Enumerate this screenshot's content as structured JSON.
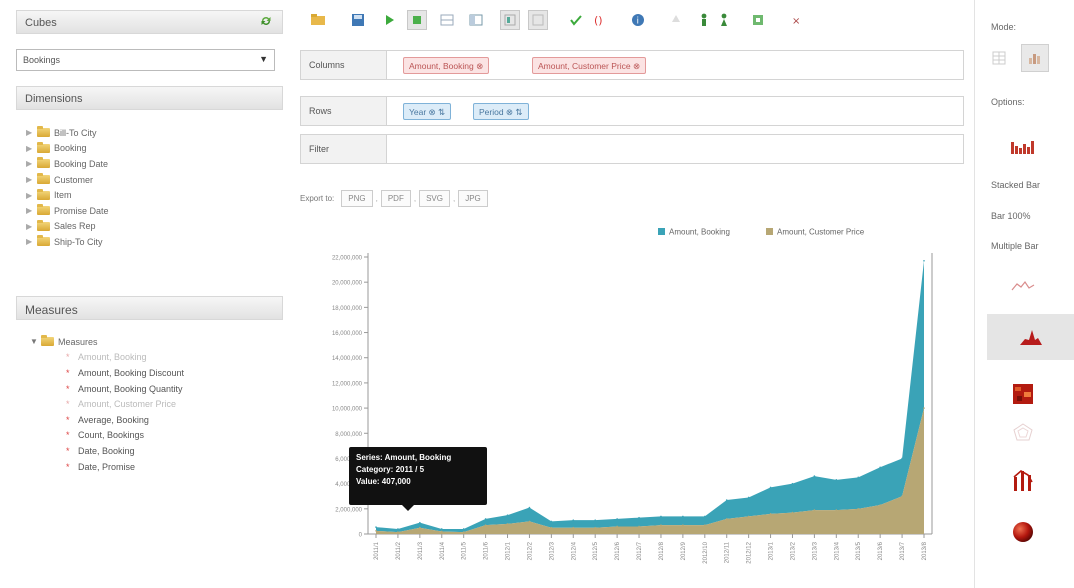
{
  "cubes": {
    "title": "Cubes",
    "selected": "Bookings"
  },
  "dimensions": {
    "title": "Dimensions",
    "items": [
      "Bill-To City",
      "Booking",
      "Booking Date",
      "Customer",
      "Item",
      "Promise Date",
      "Sales Rep",
      "Ship-To City"
    ]
  },
  "measures": {
    "title": "Measures",
    "folder": "Measures",
    "items": [
      {
        "label": "Amount, Booking",
        "used": true
      },
      {
        "label": "Amount, Booking Discount",
        "used": false
      },
      {
        "label": "Amount, Booking Quantity",
        "used": false
      },
      {
        "label": "Amount, Customer Price",
        "used": true
      },
      {
        "label": "Average, Booking",
        "used": false
      },
      {
        "label": "Count, Bookings",
        "used": false
      },
      {
        "label": "Date, Booking",
        "used": false
      },
      {
        "label": "Date, Promise",
        "used": false
      }
    ]
  },
  "toolbar": {
    "buttons": [
      "open-folder-icon",
      "save-icon",
      "play-icon",
      "run-icon",
      "grid-icon",
      "split-icon",
      "layout-icon",
      "blank-icon",
      "check-icon",
      "bracket-icon",
      "info-icon",
      "up-icon",
      "person-icon",
      "person2-icon",
      "export-icon",
      "close-icon"
    ]
  },
  "zones": {
    "columns": {
      "label": "Columns",
      "pills": [
        "Amount, Booking ⊗",
        "Amount, Customer Price ⊗"
      ]
    },
    "rows": {
      "label": "Rows",
      "pills": [
        "Year ⊗ ⇅",
        "Period ⊗ ⇅"
      ]
    },
    "filter": {
      "label": "Filter",
      "pills": []
    }
  },
  "export": {
    "label": "Export to:",
    "formats": [
      "PNG",
      "PDF",
      "SVG",
      "JPG"
    ]
  },
  "tooltip": {
    "series": "Series: Amount, Booking",
    "category": "Category: 2011 / 5",
    "value": "Value: 407,000"
  },
  "right": {
    "mode_label": "Mode:",
    "options_label": "Options:",
    "text_options": [
      "Stacked Bar",
      "Bar 100%",
      "Multiple Bar"
    ]
  },
  "chart_data": {
    "type": "area",
    "stacked": true,
    "legend_position": "top-right",
    "ylim": [
      0,
      22000000
    ],
    "y_ticks": [
      "22,000,000",
      "20,000,000",
      "18,000,000",
      "16,000,000",
      "14,000,000",
      "12,000,000",
      "10,000,000",
      "8,000,000",
      "6,000,000",
      "4,000,000",
      "2,000,000",
      "0"
    ],
    "categories": [
      "2011/1",
      "2011/2",
      "2011/3",
      "2011/4",
      "2011/5",
      "2011/6",
      "2012/1",
      "2012/2",
      "2012/3",
      "2012/4",
      "2012/5",
      "2012/6",
      "2012/7",
      "2012/8",
      "2012/9",
      "2012/10",
      "2012/11",
      "2012/12",
      "2013/1",
      "2013/2",
      "2013/3",
      "2013/4",
      "2013/5",
      "2013/6",
      "2013/7",
      "2013/8"
    ],
    "series": [
      {
        "name": "Amount, Customer Price",
        "color": "#b7a774",
        "values": [
          250000,
          150000,
          500000,
          200000,
          150000,
          700000,
          800000,
          1000000,
          500000,
          500000,
          500000,
          600000,
          600000,
          700000,
          700000,
          700000,
          1200000,
          1400000,
          1600000,
          1700000,
          1900000,
          1900000,
          2000000,
          2300000,
          3000000,
          10000000
        ]
      },
      {
        "name": "Amount, Booking",
        "color": "#3aa3b7",
        "values": [
          300000,
          250000,
          400000,
          200000,
          250000,
          500000,
          700000,
          1100000,
          500000,
          600000,
          600000,
          600000,
          700000,
          700000,
          700000,
          700000,
          1500000,
          1500000,
          2100000,
          2300000,
          2700000,
          2400000,
          2500000,
          3000000,
          3000000,
          11700000
        ]
      }
    ]
  }
}
